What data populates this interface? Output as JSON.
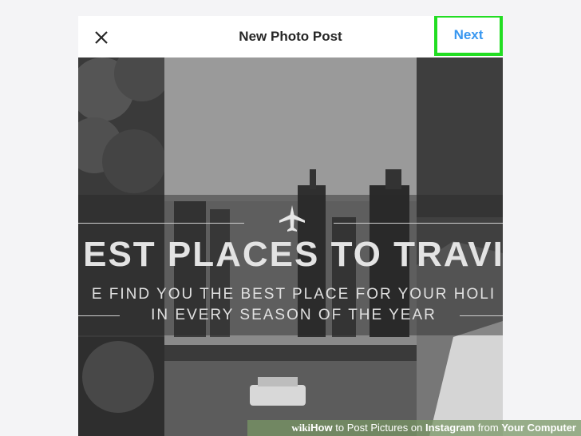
{
  "dialog": {
    "title": "New Photo Post",
    "close_icon": "close-icon",
    "next_label": "Next",
    "highlight_color": "#22dd22",
    "next_color": "#3897f0"
  },
  "photo": {
    "headline": "EST PLACES TO TRAVI",
    "subline_1": "E FIND YOU THE BEST PLACE FOR YOUR HOLI",
    "subline_2": "IN EVERY SEASON OF THE YEAR",
    "plane_icon": "airplane-icon"
  },
  "watermark": {
    "brand": "wiki",
    "how": "How",
    "text_1": " to Post Pictures on ",
    "text_2": "Instagram",
    "text_3": " from ",
    "text_4": "Your Computer"
  }
}
